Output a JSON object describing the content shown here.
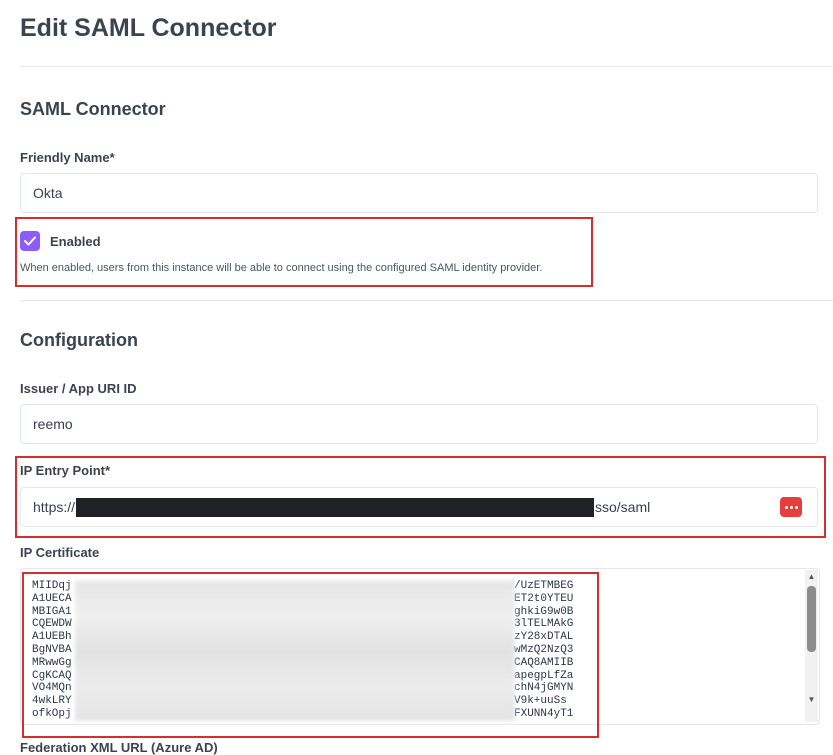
{
  "page": {
    "title": "Edit SAML Connector"
  },
  "saml_section": {
    "title": "SAML Connector",
    "friendly_name_label": "Friendly Name*",
    "friendly_name_value": "Okta",
    "enabled_label": "Enabled",
    "enabled_checked": true,
    "enabled_help": "When enabled, users from this instance will be able to connect using the configured SAML identity provider."
  },
  "configuration": {
    "title": "Configuration",
    "issuer_label": "Issuer / App URI ID",
    "issuer_value": "reemo",
    "entry_point_label": "IP Entry Point*",
    "entry_point_prefix": "https://",
    "entry_point_suffix": "sso/saml",
    "certificate_label": "IP Certificate",
    "certificate_left": "MIIDqj\nA1UECA\nMBIGA1\nCQEWDW\nA1UEBh\nBgNVBA\nMRwwGg\nCgKCAQ\nVO4MQn\n4wkLRY\nofkOpj",
    "certificate_right": "/UzETMBEG\nET2t0YTEU\nghkiG9w0B\n3lTELMAkG\nzY28xDTAL\nwMzQ2NzQ3\nCAQ8AMIIB\napegpLfZa\nchN4jGMYN\nV9k+uuSs\nFXUNN4yT1",
    "federation_label": "Federation XML URL (Azure AD)"
  },
  "colors": {
    "accent": "#8b5cf6",
    "highlight_border": "#d32f2f",
    "password_icon": "#e53e3e"
  },
  "icons": {
    "checkbox": "check-icon",
    "password_manager": "password-manager-icon"
  }
}
